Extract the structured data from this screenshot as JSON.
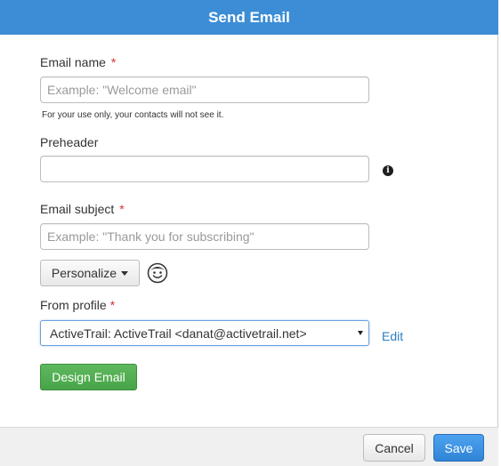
{
  "dialog": {
    "title": "Send Email"
  },
  "email_name": {
    "label": "Email name",
    "required_mark": "*",
    "placeholder": "Example: \"Welcome email\"",
    "value": "",
    "help": "For your use only, your contacts will not see it."
  },
  "preheader": {
    "label": "Preheader",
    "value": "",
    "info_icon": "info-icon"
  },
  "email_subject": {
    "label": "Email subject",
    "required_mark": "*",
    "placeholder": "Example: \"Thank you for subscribing\"",
    "value": ""
  },
  "personalize": {
    "label": "Personalize",
    "emoji_icon": "smiley-icon"
  },
  "from_profile": {
    "label": "From profile",
    "required_mark": "*",
    "selected": "ActiveTrail: ActiveTrail <danat@activetrail.net>",
    "edit_label": "Edit"
  },
  "design_button": {
    "label": "Design Email"
  },
  "footer": {
    "cancel_label": "Cancel",
    "save_label": "Save"
  },
  "colors": {
    "header": "#3c8dd6",
    "required": "#d9302b",
    "design_button": "#47a447",
    "save_button": "#2f84d6",
    "link": "#2a7fc4"
  }
}
